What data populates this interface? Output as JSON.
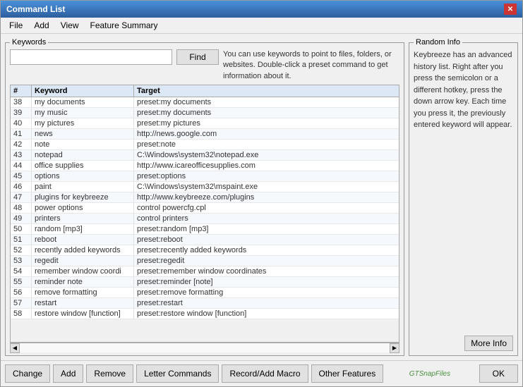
{
  "window": {
    "title": "Command List",
    "close_label": "✕"
  },
  "menu": {
    "items": [
      "File",
      "Add",
      "View",
      "Feature Summary"
    ]
  },
  "keywords_section": {
    "legend": "Keywords",
    "input_value": "",
    "input_placeholder": "",
    "find_button": "Find",
    "help_text": "You can use keywords to point to files, folders, or websites. Double-click a preset command to get information about it."
  },
  "table": {
    "columns": [
      "#",
      "Keyword",
      "Target"
    ],
    "rows": [
      {
        "num": "38",
        "keyword": "my documents",
        "target": "preset:my documents"
      },
      {
        "num": "39",
        "keyword": "my music",
        "target": "preset:my documents"
      },
      {
        "num": "40",
        "keyword": "my pictures",
        "target": "preset:my pictures"
      },
      {
        "num": "41",
        "keyword": "news",
        "target": "http://news.google.com"
      },
      {
        "num": "42",
        "keyword": "note",
        "target": "preset:note"
      },
      {
        "num": "43",
        "keyword": "notepad",
        "target": "C:\\Windows\\system32\\notepad.exe"
      },
      {
        "num": "44",
        "keyword": "office supplies",
        "target": "http://www.icareofficesupplies.com"
      },
      {
        "num": "45",
        "keyword": "options",
        "target": "preset:options"
      },
      {
        "num": "46",
        "keyword": "paint",
        "target": "C:\\Windows\\system32\\mspaint.exe"
      },
      {
        "num": "47",
        "keyword": "plugins for keybreeze",
        "target": "http://www.keybreeze.com/plugins"
      },
      {
        "num": "48",
        "keyword": "power options",
        "target": "control powercfg.cpl"
      },
      {
        "num": "49",
        "keyword": "printers",
        "target": "control printers"
      },
      {
        "num": "50",
        "keyword": "random [mp3]",
        "target": "preset:random [mp3]"
      },
      {
        "num": "51",
        "keyword": "reboot",
        "target": "preset:reboot"
      },
      {
        "num": "52",
        "keyword": "recently added keywords",
        "target": "preset:recently added keywords"
      },
      {
        "num": "53",
        "keyword": "regedit",
        "target": "preset:regedit"
      },
      {
        "num": "54",
        "keyword": "remember window coordi",
        "target": "preset:remember window coordinates"
      },
      {
        "num": "55",
        "keyword": "reminder note",
        "target": "preset:reminder [note]"
      },
      {
        "num": "56",
        "keyword": "remove formatting",
        "target": "preset:remove formatting"
      },
      {
        "num": "57",
        "keyword": "restart",
        "target": "preset:restart"
      },
      {
        "num": "58",
        "keyword": "restore window [function]",
        "target": "preset:restore window [function]"
      }
    ]
  },
  "random_info": {
    "legend": "Random Info",
    "text": "Keybreeze has an advanced history list. Right after you press the semicolon or a different hotkey, press the down arrow key. Each time you press it, the previously entered keyword will appear.",
    "more_info_button": "More Info"
  },
  "bottom_bar": {
    "change_button": "Change",
    "add_button": "Add",
    "remove_button": "Remove",
    "letter_commands_button": "Letter Commands",
    "record_add_macro_button": "Record/Add Macro",
    "other_features_button": "Other Features",
    "ok_button": "OK",
    "watermark": "GTSnapFiles"
  }
}
